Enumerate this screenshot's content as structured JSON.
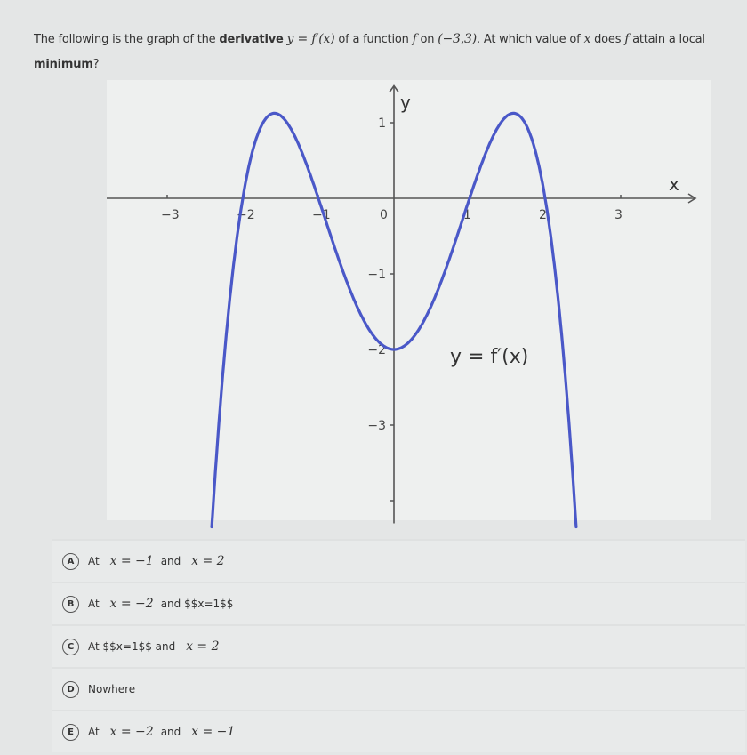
{
  "question": {
    "part1": "The following is the graph of the ",
    "bold": "derivative",
    "math1": "y = f′(x)",
    "part2": " of a function ",
    "math2": "f",
    "part3": " on ",
    "math3": "(−3,3)",
    "part4": ". At which value of ",
    "math4": "x",
    "part5": " does ",
    "math5": "f",
    "part6": " attain a local ",
    "bold2": "minimum",
    "part7": "?"
  },
  "chart_data": {
    "type": "line",
    "title": "",
    "xlabel": "x",
    "ylabel": "y",
    "curve_label": "y = f′(x)",
    "x_ticks": [
      -3,
      -2,
      -1,
      0,
      1,
      2,
      3
    ],
    "x_tick_labels": [
      "−3",
      "−2",
      "−1",
      "0",
      "1",
      "2",
      "3"
    ],
    "y_ticks": [
      1,
      -1,
      -2,
      -3,
      -4
    ],
    "y_tick_labels": [
      "1",
      "−1",
      "−2",
      "−3",
      ""
    ],
    "xlim": [
      -3.8,
      4.0
    ],
    "ylim": [
      -4.3,
      1.5
    ],
    "grid": false,
    "series": [
      {
        "name": "f'(x)",
        "color": "#4a58c8",
        "formula": "-0.5*(x^2-1)*(x^2-4)",
        "x_range": [
          -2.41,
          2.41
        ],
        "key_points": [
          {
            "x": -2,
            "y": 0
          },
          {
            "x": -1.58,
            "y": 1.13
          },
          {
            "x": -1,
            "y": 0
          },
          {
            "x": 0,
            "y": -2
          },
          {
            "x": 1,
            "y": 0
          },
          {
            "x": 1.58,
            "y": 1.13
          },
          {
            "x": 2,
            "y": 0
          }
        ]
      }
    ]
  },
  "options": [
    {
      "letter": "A",
      "pre": "At",
      "m1": "x = −1",
      "mid": "and",
      "m2": "x = 2",
      "post": ""
    },
    {
      "letter": "B",
      "pre": "At",
      "m1": "x = −2",
      "mid": "and $$x=1$$",
      "m2": "",
      "post": ""
    },
    {
      "letter": "C",
      "pre": "At $$x=1$$ and",
      "m1": "",
      "mid": "",
      "m2": "x = 2",
      "post": ""
    },
    {
      "letter": "D",
      "pre": "Nowhere",
      "m1": "",
      "mid": "",
      "m2": "",
      "post": ""
    },
    {
      "letter": "E",
      "pre": "At",
      "m1": "x = −2",
      "mid": "and",
      "m2": "x = −1",
      "post": ""
    }
  ]
}
